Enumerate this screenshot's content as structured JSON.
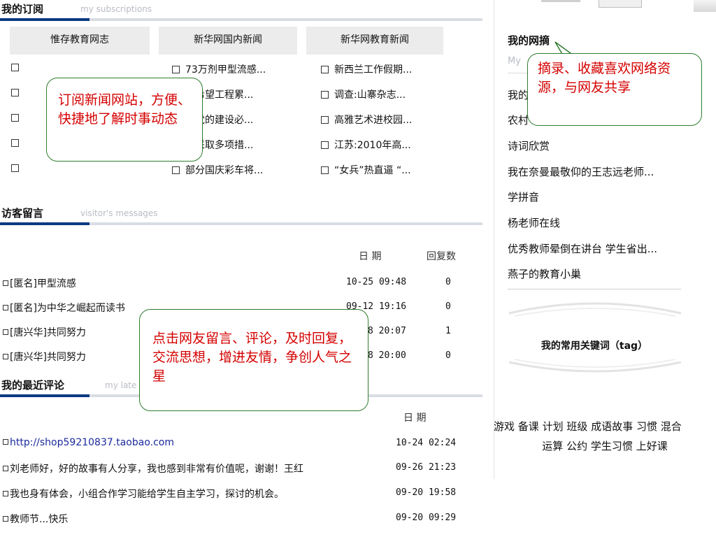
{
  "subscriptions": {
    "title": "我的订阅",
    "title_en": "my subscriptions",
    "columns": [
      {
        "header": "惟存教育网志",
        "items": [
          "",
          "",
          "",
          "",
          ""
        ]
      },
      {
        "header": "新华网国内新闻",
        "items": [
          "73万剂甲型流感...",
          "西希望工程累...",
          "河党的建设必...",
          "国采取多项措...",
          "部分国庆彩车将..."
        ]
      },
      {
        "header": "新华网教育新闻",
        "items": [
          "新西兰工作假期...",
          "调查:山寨杂志...",
          "高雅艺术进校园...",
          "江苏:2010年高...",
          "“女兵”热直逼 “..."
        ]
      }
    ]
  },
  "visitor": {
    "title": "访客留言",
    "title_en": "visitor's messages",
    "col_date": "日 期",
    "col_replies": "回复数",
    "rows": [
      {
        "author": "匿名",
        "text": "甲型流感",
        "date": "10-25 09:48",
        "replies": "0"
      },
      {
        "author": "匿名",
        "text": "为中华之崛起而读书",
        "date": "09-12 19:16",
        "replies": "0"
      },
      {
        "author": "唐兴华",
        "text": "共同努力",
        "date": "8 20:07",
        "replies": "1"
      },
      {
        "author": "唐兴华",
        "text": "共同努力",
        "date": "8 20:00",
        "replies": "0"
      }
    ]
  },
  "comments": {
    "title": "我的最近评论",
    "title_en": "my late",
    "col_date": "日 期",
    "rows": [
      {
        "text": "http://shop59210837.taobao.com",
        "date": "10-24 02:24",
        "link": true
      },
      {
        "text": "刘老师好，好的故事有人分享，我也感到非常有价值呢，谢谢！王红",
        "date": "09-26 21:23",
        "link": false
      },
      {
        "text": "我也身有体会，小组合作学习能给学生自主学习，探讨的机会。",
        "date": "09-20 19:58",
        "link": false
      },
      {
        "text": "教师节...快乐",
        "date": "09-20 09:29",
        "link": false
      }
    ]
  },
  "netclip": {
    "title": "我的网摘",
    "title_en": "My",
    "items": [
      "我的",
      "农村",
      "诗词欣赏",
      "我在奈曼最敬仰的王志远老师...",
      "学拼音",
      "杨老师在线",
      "优秀教师晕倒在讲台 学生省出...",
      "燕子的教育小巢"
    ]
  },
  "tags": {
    "title": "我的常用关键词（tag）",
    "line1": [
      "游戏",
      "备课",
      "计划",
      "班级",
      "成语故事",
      "习惯",
      "混合"
    ],
    "line2": [
      "运算",
      "公约",
      "学生习惯",
      "上好课"
    ]
  },
  "callouts": {
    "subscribe": "订阅新闻网站，方便、快捷地了解时事动态",
    "netclip": "摘录、收藏喜欢网络资源，与网友共享",
    "messages": "点击网友留言、评论，及时回复，交流思想，增进友情，争创人气之星"
  },
  "colors": {
    "accent": "#0b3a82",
    "callout_text": "#d40000",
    "callout_border": "#2e7d2e",
    "link": "#1a2a9c"
  }
}
